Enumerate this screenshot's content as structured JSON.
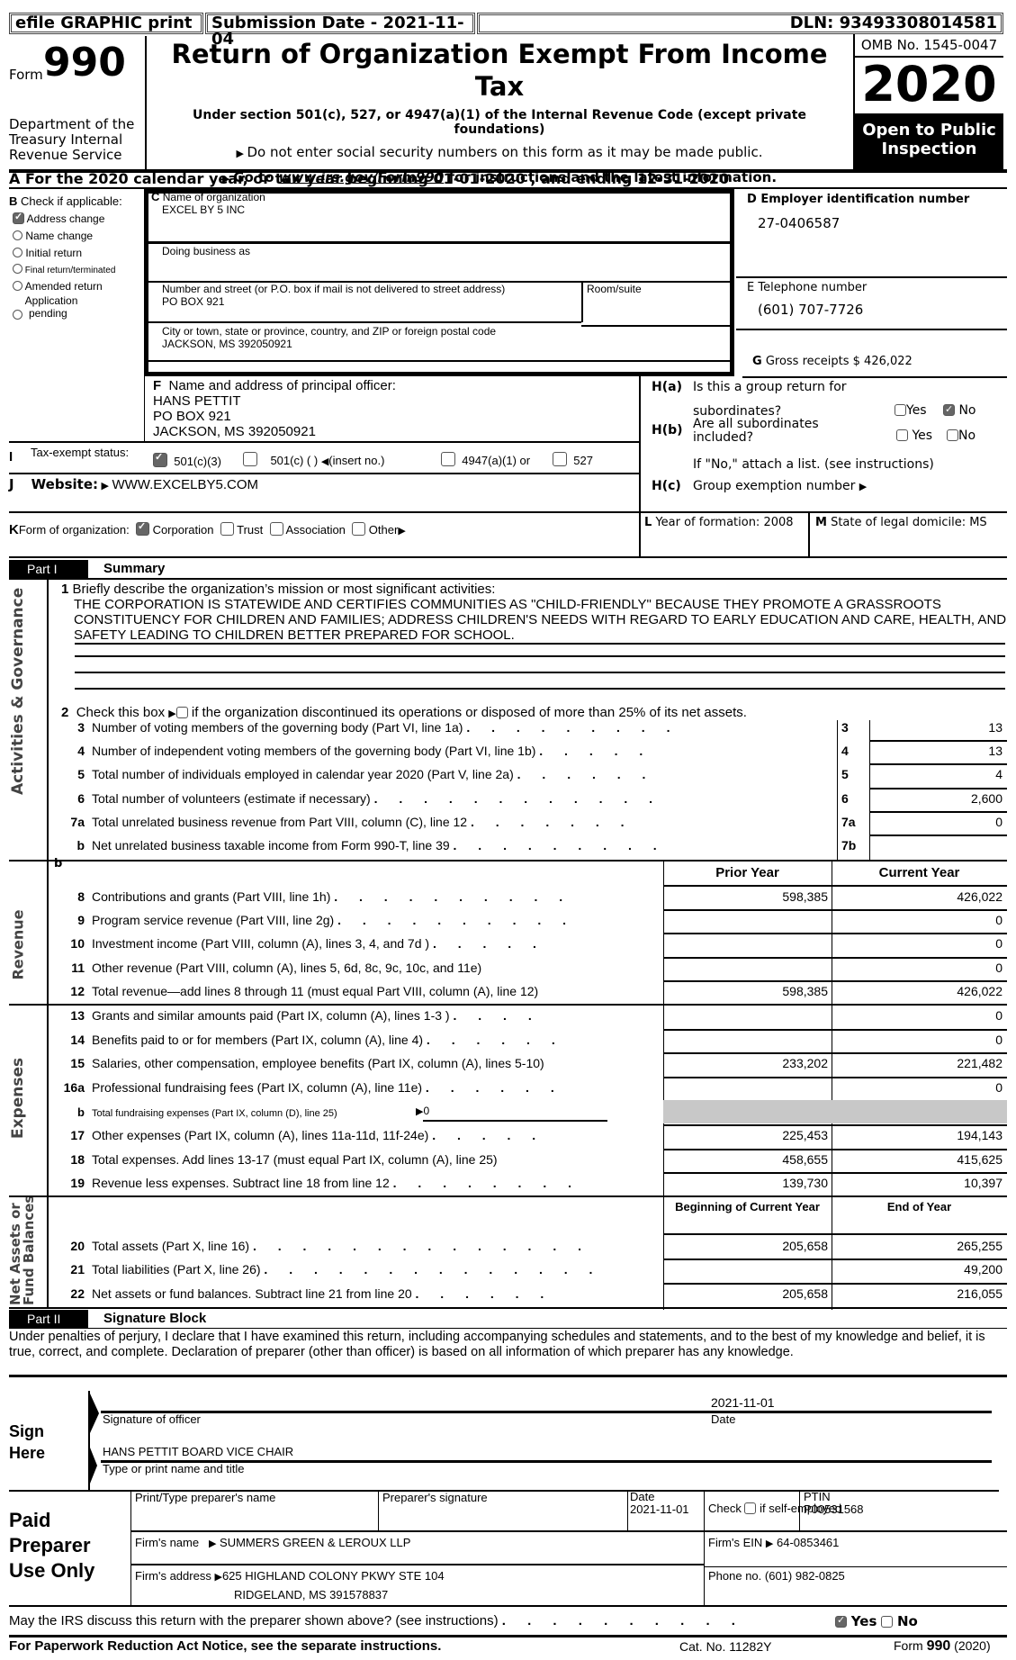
{
  "header": {
    "efile": "efile GRAPHIC print",
    "submission": "Submission Date - 2021-11-04",
    "dln": "DLN: 93493308014581"
  },
  "form": {
    "form_word": "Form",
    "form_number": "990",
    "department": "Department of the Treasury Internal Revenue Service",
    "title": "Return of Organization Exempt From Income Tax",
    "subtitle": "Under section 501(c), 527, or 4947(a)(1) of the Internal Revenue Code (except private foundations)",
    "notice1": "Do not enter social security numbers on this form as it may be made public.",
    "notice2_pre": "Go to ",
    "notice2_link": "www.irs.gov/Form990",
    "notice2_post": " for instructions and the latest information.",
    "omb": "OMB No. 1545-0047",
    "year": "2020",
    "open_public": "Open to Public Inspection"
  },
  "line_a": "A  For the 2020 calendar year, or tax year beginning 01-01-2020    , and ending 12-31-2020",
  "section_b": {
    "title": "Check if applicable:",
    "letter": "B",
    "items": [
      {
        "label": "Address change",
        "checked": true
      },
      {
        "label": "Name change",
        "checked": false
      },
      {
        "label": "Initial return",
        "checked": false
      },
      {
        "label": "Final return/terminated",
        "checked": false
      },
      {
        "label": "Amended return",
        "checked": false
      },
      {
        "label": "Application pending",
        "checked": false
      }
    ]
  },
  "section_c": {
    "name_label": "Name of organization",
    "name": "EXCEL BY 5 INC",
    "dba_label": "Doing business as",
    "street_label": "Number and street (or P.O. box if mail is not delivered to street address)",
    "street": "PO BOX 921",
    "room_label": "Room/suite",
    "city_label": "City or town, state or province, country, and ZIP or foreign postal code",
    "city": "JACKSON, MS  392050921"
  },
  "section_d": {
    "label": "D Employer identification number",
    "value": "27-0406587"
  },
  "section_e": {
    "label": "E Telephone number",
    "value": "(601) 707-7726"
  },
  "section_g": {
    "label": "G",
    "text": "Gross receipts $ 426,022"
  },
  "section_f": {
    "label": "Name and address of principal officer:",
    "letter": "F",
    "name": "HANS PETTIT",
    "address1": "PO BOX 921",
    "address2": "JACKSON, MS  392050921"
  },
  "section_h": {
    "ha_label": "H(a)",
    "ha_text1": "Is this a group return for",
    "ha_text2": "subordinates?",
    "hb_label": "H(b)",
    "hb_text": "Are all subordinates included?",
    "hb_note": "If \"No,\" attach a list. (see instructions)",
    "hc_label": "H(c)",
    "hc_text": "Group exemption number",
    "yes": "Yes",
    "no": "No"
  },
  "section_i": {
    "letter": "I",
    "label": "Tax-exempt status:",
    "opt1": "501(c)(3)",
    "opt2": "501(c) (   )",
    "opt2_note": "(insert no.)",
    "opt3": "4947(a)(1) or",
    "opt4": "527"
  },
  "section_j": {
    "letter": "J",
    "label": "Website:",
    "value": "WWW.EXCELBY5.COM"
  },
  "section_k": {
    "letter": "K",
    "label": "Form of organization:",
    "opts": [
      "Corporation",
      "Trust",
      "Association",
      "Other"
    ]
  },
  "section_l": {
    "letter": "L",
    "text": "Year of formation: 2008"
  },
  "section_m": {
    "letter": "M",
    "text": "State of legal domicile: MS"
  },
  "part1": {
    "label": "Part I",
    "title": "Summary",
    "side_gov": "Activities & Governance",
    "side_rev": "Revenue",
    "side_exp": "Expenses",
    "side_net1": "Net Assets or",
    "side_net2": "Fund Balances",
    "line1_num": "1",
    "line1_text": "Briefly describe the organization’s mission or most significant activities:",
    "mission": [
      "THE CORPORATION IS STATEWIDE AND CERTIFIES COMMUNITIES AS \"CHILD-FRIENDLY\" BECAUSE THEY PROMOTE A GRASSROOTS",
      "CONSTITUENCY FOR CHILDREN AND FAMILIES; ADDRESS CHILDREN'S NEEDS WITH REGARD TO EARLY EDUCATION AND CARE, HEALTH, AND",
      "SAFETY LEADING TO CHILDREN BETTER PREPARED FOR SCHOOL."
    ],
    "line2_num": "2",
    "line2_pre": "Check this box",
    "line2_post": "if the organization discontinued its operations or disposed of more than 25% of its net assets.",
    "gov_lines": [
      {
        "num": "3",
        "text": "Number of voting members of the governing body (Part VI, line 1a)",
        "dots": ". . . . . . . . .",
        "box": "3",
        "value": "13"
      },
      {
        "num": "4",
        "text": "Number of independent voting members of the governing body (Part VI, line 1b)",
        "dots": ". . . . .",
        "box": "4",
        "value": "13"
      },
      {
        "num": "5",
        "text": "Total number of individuals employed in calendar year 2020 (Part V, line 2a)",
        "dots": ". . . . . .",
        "box": "5",
        "value": "4"
      },
      {
        "num": "6",
        "text": "Total number of volunteers (estimate if necessary)",
        "dots": ". . . . . . . . . . . .",
        "box": "6",
        "value": "2,600"
      },
      {
        "num": "7a",
        "text": "Total unrelated business revenue from Part VIII, column (C), line 12",
        "dots": ". . . . . . .",
        "box": "7a",
        "value": "0"
      },
      {
        "num": "b",
        "text": "Net unrelated business taxable income from Form 990-T, line 39",
        "dots": ". . . . . . . . .",
        "box": "7b",
        "value": ""
      }
    ],
    "col_prior": "Prior Year",
    "col_current": "Current Year",
    "revenue_lines": [
      {
        "num": "8",
        "text": "Contributions and grants (Part VIII, line 1h)",
        "dots": ". . . . . . . . . .",
        "prior": "598,385",
        "current": "426,022"
      },
      {
        "num": "9",
        "text": "Program service revenue (Part VIII, line 2g)",
        "dots": ". . . . . . . . . .",
        "prior": "",
        "current": "0"
      },
      {
        "num": "10",
        "text": "Investment income (Part VIII, column (A), lines 3, 4, and 7d )",
        "dots": ". . . . .",
        "prior": "",
        "current": "0"
      },
      {
        "num": "11",
        "text": "Other revenue (Part VIII, column (A), lines 5, 6d, 8c, 9c, 10c, and 11e)",
        "dots": "",
        "prior": "",
        "current": "0"
      },
      {
        "num": "12",
        "text": "Total revenue—add lines 8 through 11 (must equal Part VIII, column (A), line 12)",
        "dots": "",
        "prior": "598,385",
        "current": "426,022"
      }
    ],
    "expense_lines": [
      {
        "num": "13",
        "text": "Grants and similar amounts paid (Part IX, column (A), lines 1-3 )",
        "dots": ". . . .",
        "prior": "",
        "current": "0"
      },
      {
        "num": "14",
        "text": "Benefits paid to or for members (Part IX, column (A), line 4)",
        "dots": ". . . . . .",
        "prior": "",
        "current": "0"
      },
      {
        "num": "15",
        "text": "Salaries, other compensation, employee benefits (Part IX, column (A), lines 5-10)",
        "dots": "",
        "prior": "233,202",
        "current": "221,482"
      },
      {
        "num": "16a",
        "text": "Professional fundraising fees (Part IX, column (A), line 11e)",
        "dots": ". . . . . .",
        "prior": "",
        "current": "0"
      },
      {
        "num": "b",
        "text": "Total fundraising expenses (Part IX, column (D), line 25)",
        "dots": "",
        "prior": "",
        "current": "",
        "extra": "0"
      },
      {
        "num": "17",
        "text": "Other expenses (Part IX, column (A), lines 11a-11d, 11f-24e)",
        "dots": ". . . . .",
        "prior": "225,453",
        "current": "194,143"
      },
      {
        "num": "18",
        "text": "Total expenses. Add lines 13-17 (must equal Part IX, column (A), line 25)",
        "dots": "",
        "prior": "458,655",
        "current": "415,625"
      },
      {
        "num": "19",
        "text": "Revenue less expenses. Subtract line 18 from line 12",
        "dots": ". . . . . . . .",
        "prior": "139,730",
        "current": "10,397"
      }
    ],
    "col_begin": "Beginning of Current Year",
    "col_end": "End of Year",
    "net_lines": [
      {
        "num": "20",
        "text": "Total assets (Part X, line 16)",
        "dots": ". . . . . . . . . . . . . .",
        "begin": "205,658",
        "end": "265,255"
      },
      {
        "num": "21",
        "text": "Total liabilities (Part X, line 26)",
        "dots": ". . . . . . . . . . . . . .",
        "begin": "",
        "end": "49,200"
      },
      {
        "num": "22",
        "text": "Net assets or fund balances. Subtract line 21 from line 20",
        "dots": ". . . . . .",
        "begin": "205,658",
        "end": "216,055"
      }
    ]
  },
  "part2": {
    "label": "Part II",
    "title": "Signature Block",
    "penalty": "Under penalties of perjury, I declare that I have examined this return, including accompanying schedules and statements, and to the best of my knowledge and belief, it is true, correct, and complete. Declaration of preparer (other than officer) is based on all information of which preparer has any knowledge.",
    "sign_here": "Sign Here",
    "sig_label": "Signature of officer",
    "date_value": "2021-11-01",
    "date_label": "Date",
    "name_title": "HANS PETTIT  BOARD VICE CHAIR",
    "name_title_label": "Type or print name and title"
  },
  "preparer": {
    "heading": "Paid Preparer Use Only",
    "name_label": "Print/Type preparer's name",
    "sig_label": "Preparer's signature",
    "date_label": "Date",
    "date_value": "2021-11-01",
    "check_pre": "Check",
    "check_post": "if self-employed",
    "ptin_label": "PTIN",
    "ptin_value": "P00531568",
    "firm_name_label": "Firm's name",
    "firm_name": "SUMMERS GREEN & LEROUX LLP",
    "firm_ein_label": "Firm's EIN",
    "firm_ein": "64-0853461",
    "firm_address_label": "Firm's address",
    "firm_address1": "625 HIGHLAND COLONY PKWY STE 104",
    "firm_address2": "RIDGELAND, MS  391578837",
    "phone": "Phone no. (601) 982-0825"
  },
  "discuss": {
    "text": "May the IRS discuss this return with the preparer shown above? (see instructions)",
    "dots": ". . . . . . . . . .",
    "yes": "Yes",
    "no": "No",
    "answer": "Yes"
  },
  "footer": {
    "left": "For Paperwork Reduction Act Notice, see the separate instructions.",
    "cat": "Cat. No. 11282Y",
    "form_pre": "Form ",
    "form_num": "990",
    "form_year": " (2020)"
  }
}
